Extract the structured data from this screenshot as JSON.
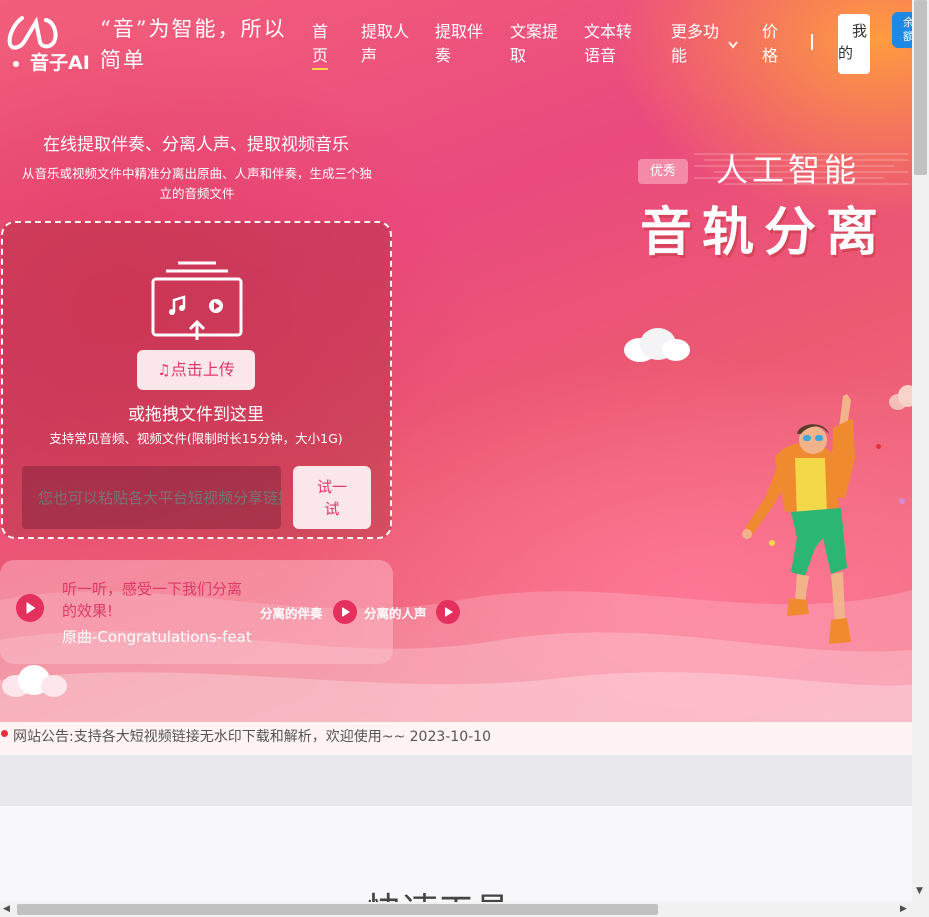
{
  "header": {
    "logo_text": "音子AI",
    "slogan": "“音”为智能，所以简单",
    "nav": [
      {
        "label": "首页",
        "lines": [
          "首",
          "页"
        ],
        "active": true
      },
      {
        "label": "提取人声",
        "lines": [
          "提取人",
          "声"
        ]
      },
      {
        "label": "提取伴奏",
        "lines": [
          "提取伴",
          "奏"
        ]
      },
      {
        "label": "文案提取",
        "lines": [
          "文案提",
          "取"
        ]
      },
      {
        "label": "文本转语音",
        "lines": [
          "文本转",
          "语音"
        ]
      },
      {
        "label": "更多功能",
        "lines": [
          "更多功",
          "能"
        ]
      },
      {
        "label": "价格",
        "lines": [
          "价",
          "格"
        ]
      }
    ],
    "mine_lines": [
      "我",
      "的"
    ],
    "right_badge_lines": [
      "余",
      "额"
    ]
  },
  "hero": {
    "title": "在线提取伴奏、分离人声、提取视频音乐",
    "subtitle_lines": [
      "从音乐或视频文件中精准分离出原曲、人声和伴奏，生成三个独",
      "立的音频文件"
    ],
    "upload_button": "点击上传",
    "drag_text": "或拖拽文件到这里",
    "limit_text": "支持常见音频、视频文件(限制时长15分钟，大小1G)",
    "paste_placeholder": "您也可以粘贴各大平台短视频分享链接",
    "try_lines": [
      "试一",
      "试"
    ],
    "demo_label_lines": [
      "听一听，感受一下我们分离",
      "的效果!"
    ],
    "demo_song": "原曲-Congratulations-feat",
    "accompaniment_label": "分离的伴奏",
    "vocal_label": "分离的人声"
  },
  "promo": {
    "badge": "优秀",
    "small_title": "人工智能",
    "big_title": "音轨分离"
  },
  "notice": {
    "text": "网站公告:支持各大短视频链接无水印下载和解析，欢迎使用~~ 2023-10-10"
  },
  "section": {
    "quick_title": "快速工具"
  },
  "colors": {
    "accent": "#e52f5c",
    "button_bg": "#fbe6ea",
    "nav_underline": "#ffd84a",
    "badge_blue": "#1e88e5"
  }
}
